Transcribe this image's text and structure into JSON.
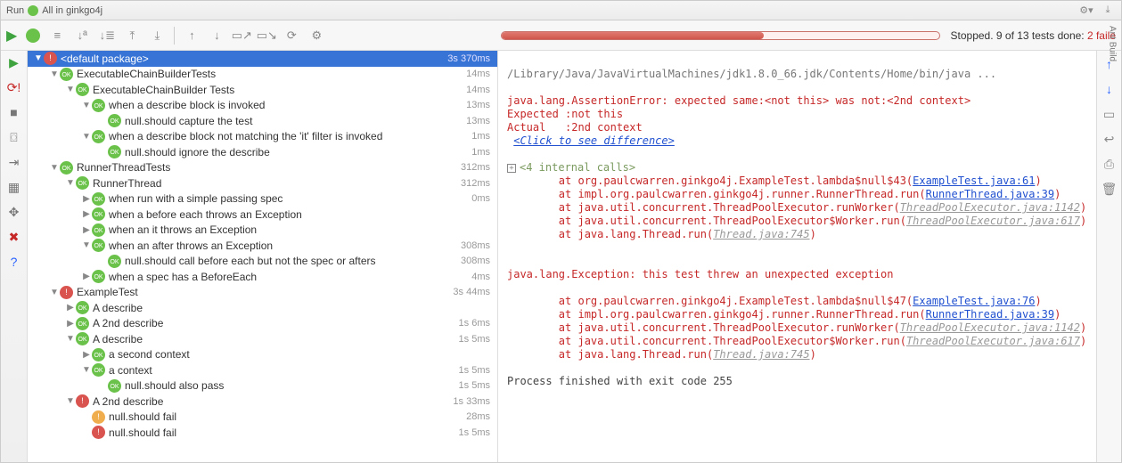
{
  "topbar": {
    "run_label": "Run",
    "config_name": "All in ginkgo4j"
  },
  "outer_rail": {
    "label": "Ant Build"
  },
  "status": {
    "text_prefix": "Stopped. 9 of 13 tests done: ",
    "fail_text": "2 faile"
  },
  "gutter": [
    {
      "name": "run-icon",
      "glyph": "▶",
      "cls": "green"
    },
    {
      "name": "rerun-failed-icon",
      "glyph": "⟳!",
      "cls": "red"
    },
    {
      "name": "stop-icon",
      "glyph": "■",
      "cls": ""
    },
    {
      "name": "camera-icon",
      "glyph": "⌼",
      "cls": ""
    },
    {
      "name": "layout-icon",
      "glyph": "⇥",
      "cls": ""
    },
    {
      "name": "monitor-icon",
      "glyph": "▦",
      "cls": ""
    },
    {
      "name": "pin-icon",
      "glyph": "✥",
      "cls": ""
    },
    {
      "name": "close-icon",
      "glyph": "✖",
      "cls": "red"
    },
    {
      "name": "help-icon",
      "glyph": "?",
      "cls": "blue"
    }
  ],
  "left_tools": [
    {
      "name": "run-button",
      "glyph": "▶",
      "cls": "play"
    },
    {
      "name": "ok-badge",
      "glyph": "",
      "cls": "badge-ok"
    },
    {
      "name": "show-passed-icon",
      "glyph": "≡",
      "cls": "tb"
    },
    {
      "name": "sort-icon",
      "glyph": "↓ª",
      "cls": "tb"
    },
    {
      "name": "sort-tree-icon",
      "glyph": "↓≣",
      "cls": "tb"
    },
    {
      "name": "expand-icon",
      "glyph": "⤒",
      "cls": "tb"
    },
    {
      "name": "collapse-icon",
      "glyph": "⤓",
      "cls": "tb"
    },
    {
      "name": "sep",
      "glyph": "",
      "cls": "sep"
    },
    {
      "name": "prev-icon",
      "glyph": "↑",
      "cls": "tb"
    },
    {
      "name": "next-icon",
      "glyph": "↓",
      "cls": "tb"
    },
    {
      "name": "export-icon",
      "glyph": "▭↗",
      "cls": "tb"
    },
    {
      "name": "import-icon",
      "glyph": "▭↘",
      "cls": "tb"
    },
    {
      "name": "history-icon",
      "glyph": "⟳",
      "cls": "tb"
    },
    {
      "name": "settings-icon",
      "glyph": "⚙",
      "cls": "tb"
    }
  ],
  "right_rail": [
    {
      "name": "up-icon",
      "glyph": "↑",
      "cls": "blue"
    },
    {
      "name": "down-icon",
      "glyph": "↓",
      "cls": "blue"
    },
    {
      "name": "export-icon",
      "glyph": "▭",
      "cls": ""
    },
    {
      "name": "wrap-icon",
      "glyph": "↩",
      "cls": ""
    },
    {
      "name": "print-icon",
      "glyph": "⎙",
      "cls": ""
    },
    {
      "name": "trash-icon",
      "glyph": "🗑",
      "cls": "trash"
    }
  ],
  "tree": [
    {
      "depth": 0,
      "arrow": "▼",
      "status": "err",
      "label": "<default package>",
      "time": "3s 370ms",
      "sel": true
    },
    {
      "depth": 1,
      "arrow": "▼",
      "status": "ok",
      "label": "ExecutableChainBuilderTests",
      "time": "14ms"
    },
    {
      "depth": 2,
      "arrow": "▼",
      "status": "ok",
      "label": "ExecutableChainBuilder Tests",
      "time": "14ms"
    },
    {
      "depth": 3,
      "arrow": "▼",
      "status": "ok",
      "label": "when a describe block is invoked",
      "time": "13ms"
    },
    {
      "depth": 4,
      "arrow": "",
      "status": "ok",
      "label": "null.should capture the test",
      "time": "13ms"
    },
    {
      "depth": 3,
      "arrow": "▼",
      "status": "ok",
      "label": "when a describe block not matching the 'it' filter is invoked",
      "time": "1ms"
    },
    {
      "depth": 4,
      "arrow": "",
      "status": "ok",
      "label": "null.should ignore the describe",
      "time": "1ms"
    },
    {
      "depth": 1,
      "arrow": "▼",
      "status": "ok",
      "label": "RunnerThreadTests",
      "time": "312ms"
    },
    {
      "depth": 2,
      "arrow": "▼",
      "status": "ok",
      "label": "RunnerThread",
      "time": "312ms"
    },
    {
      "depth": 3,
      "arrow": "▶",
      "status": "ok",
      "label": "when run with a simple passing spec",
      "time": "0ms"
    },
    {
      "depth": 3,
      "arrow": "▶",
      "status": "ok",
      "label": "when a before each throws an Exception",
      "time": ""
    },
    {
      "depth": 3,
      "arrow": "▶",
      "status": "ok",
      "label": "when an it throws an Exception",
      "time": ""
    },
    {
      "depth": 3,
      "arrow": "▼",
      "status": "ok",
      "label": "when an after throws an Exception",
      "time": "308ms"
    },
    {
      "depth": 4,
      "arrow": "",
      "status": "ok",
      "label": "null.should call before each but not the spec or afters",
      "time": "308ms"
    },
    {
      "depth": 3,
      "arrow": "▶",
      "status": "ok",
      "label": "when a spec has a BeforeEach",
      "time": "4ms"
    },
    {
      "depth": 1,
      "arrow": "▼",
      "status": "err",
      "label": "ExampleTest",
      "time": "3s 44ms"
    },
    {
      "depth": 2,
      "arrow": "▶",
      "status": "ok",
      "label": "A describe",
      "time": ""
    },
    {
      "depth": 2,
      "arrow": "▶",
      "status": "ok",
      "label": "A 2nd describe",
      "time": "1s 6ms"
    },
    {
      "depth": 2,
      "arrow": "▼",
      "status": "ok",
      "label": "A describe",
      "time": "1s 5ms"
    },
    {
      "depth": 3,
      "arrow": "▶",
      "status": "ok",
      "label": "a second context",
      "time": ""
    },
    {
      "depth": 3,
      "arrow": "▼",
      "status": "ok",
      "label": "a context",
      "time": "1s 5ms"
    },
    {
      "depth": 4,
      "arrow": "",
      "status": "ok",
      "label": "null.should also pass",
      "time": "1s 5ms"
    },
    {
      "depth": 2,
      "arrow": "▼",
      "status": "err",
      "label": "A 2nd describe",
      "time": "1s 33ms"
    },
    {
      "depth": 3,
      "arrow": "",
      "status": "warn",
      "label": "null.should fail",
      "time": "28ms"
    },
    {
      "depth": 3,
      "arrow": "",
      "status": "err",
      "label": "null.should fail",
      "time": "1s 5ms"
    }
  ],
  "console": {
    "l00": "/Library/Java/JavaVirtualMachines/jdk1.8.0_66.jdk/Contents/Home/bin/java ...",
    "l01": "",
    "l02a": "java.lang.AssertionError: expected same:<not this> was not:<2nd context>",
    "l03": "Expected :not this",
    "l04": "Actual   :2nd context",
    "l05": "<Click to see difference>",
    "l06": "",
    "fold": "<4 internal calls>",
    "s1a": "\tat org.paulcwarren.ginkgo4j.ExampleTest.lambda$null$43(",
    "s1b": "ExampleTest.java:61",
    "s2a": "\tat impl.org.paulcwarren.ginkgo4j.runner.RunnerThread.run(",
    "s2b": "RunnerThread.java:39",
    "s3a": "\tat java.util.concurrent.ThreadPoolExecutor.runWorker(",
    "s3b": "ThreadPoolExecutor.java:1142",
    "s4a": "\tat java.util.concurrent.ThreadPoolExecutor$Worker.run(",
    "s4b": "ThreadPoolExecutor.java:617",
    "s5a": "\tat java.lang.Thread.run(",
    "s5b": "Thread.java:745",
    "blank2": "",
    "ex2": "java.lang.Exception: this test threw an unexpected exception",
    "blank3": "",
    "t1a": "\tat org.paulcwarren.ginkgo4j.ExampleTest.lambda$null$47(",
    "t1b": "ExampleTest.java:76",
    "t2a": "\tat impl.org.paulcwarren.ginkgo4j.runner.RunnerThread.run(",
    "t2b": "RunnerThread.java:39",
    "t3a": "\tat java.util.concurrent.ThreadPoolExecutor.runWorker(",
    "t3b": "ThreadPoolExecutor.java:1142",
    "t4a": "\tat java.util.concurrent.ThreadPoolExecutor$Worker.run(",
    "t4b": "ThreadPoolExecutor.java:617",
    "t5a": "\tat java.lang.Thread.run(",
    "t5b": "Thread.java:745",
    "blank4": "",
    "exit": "Process finished with exit code 255"
  }
}
